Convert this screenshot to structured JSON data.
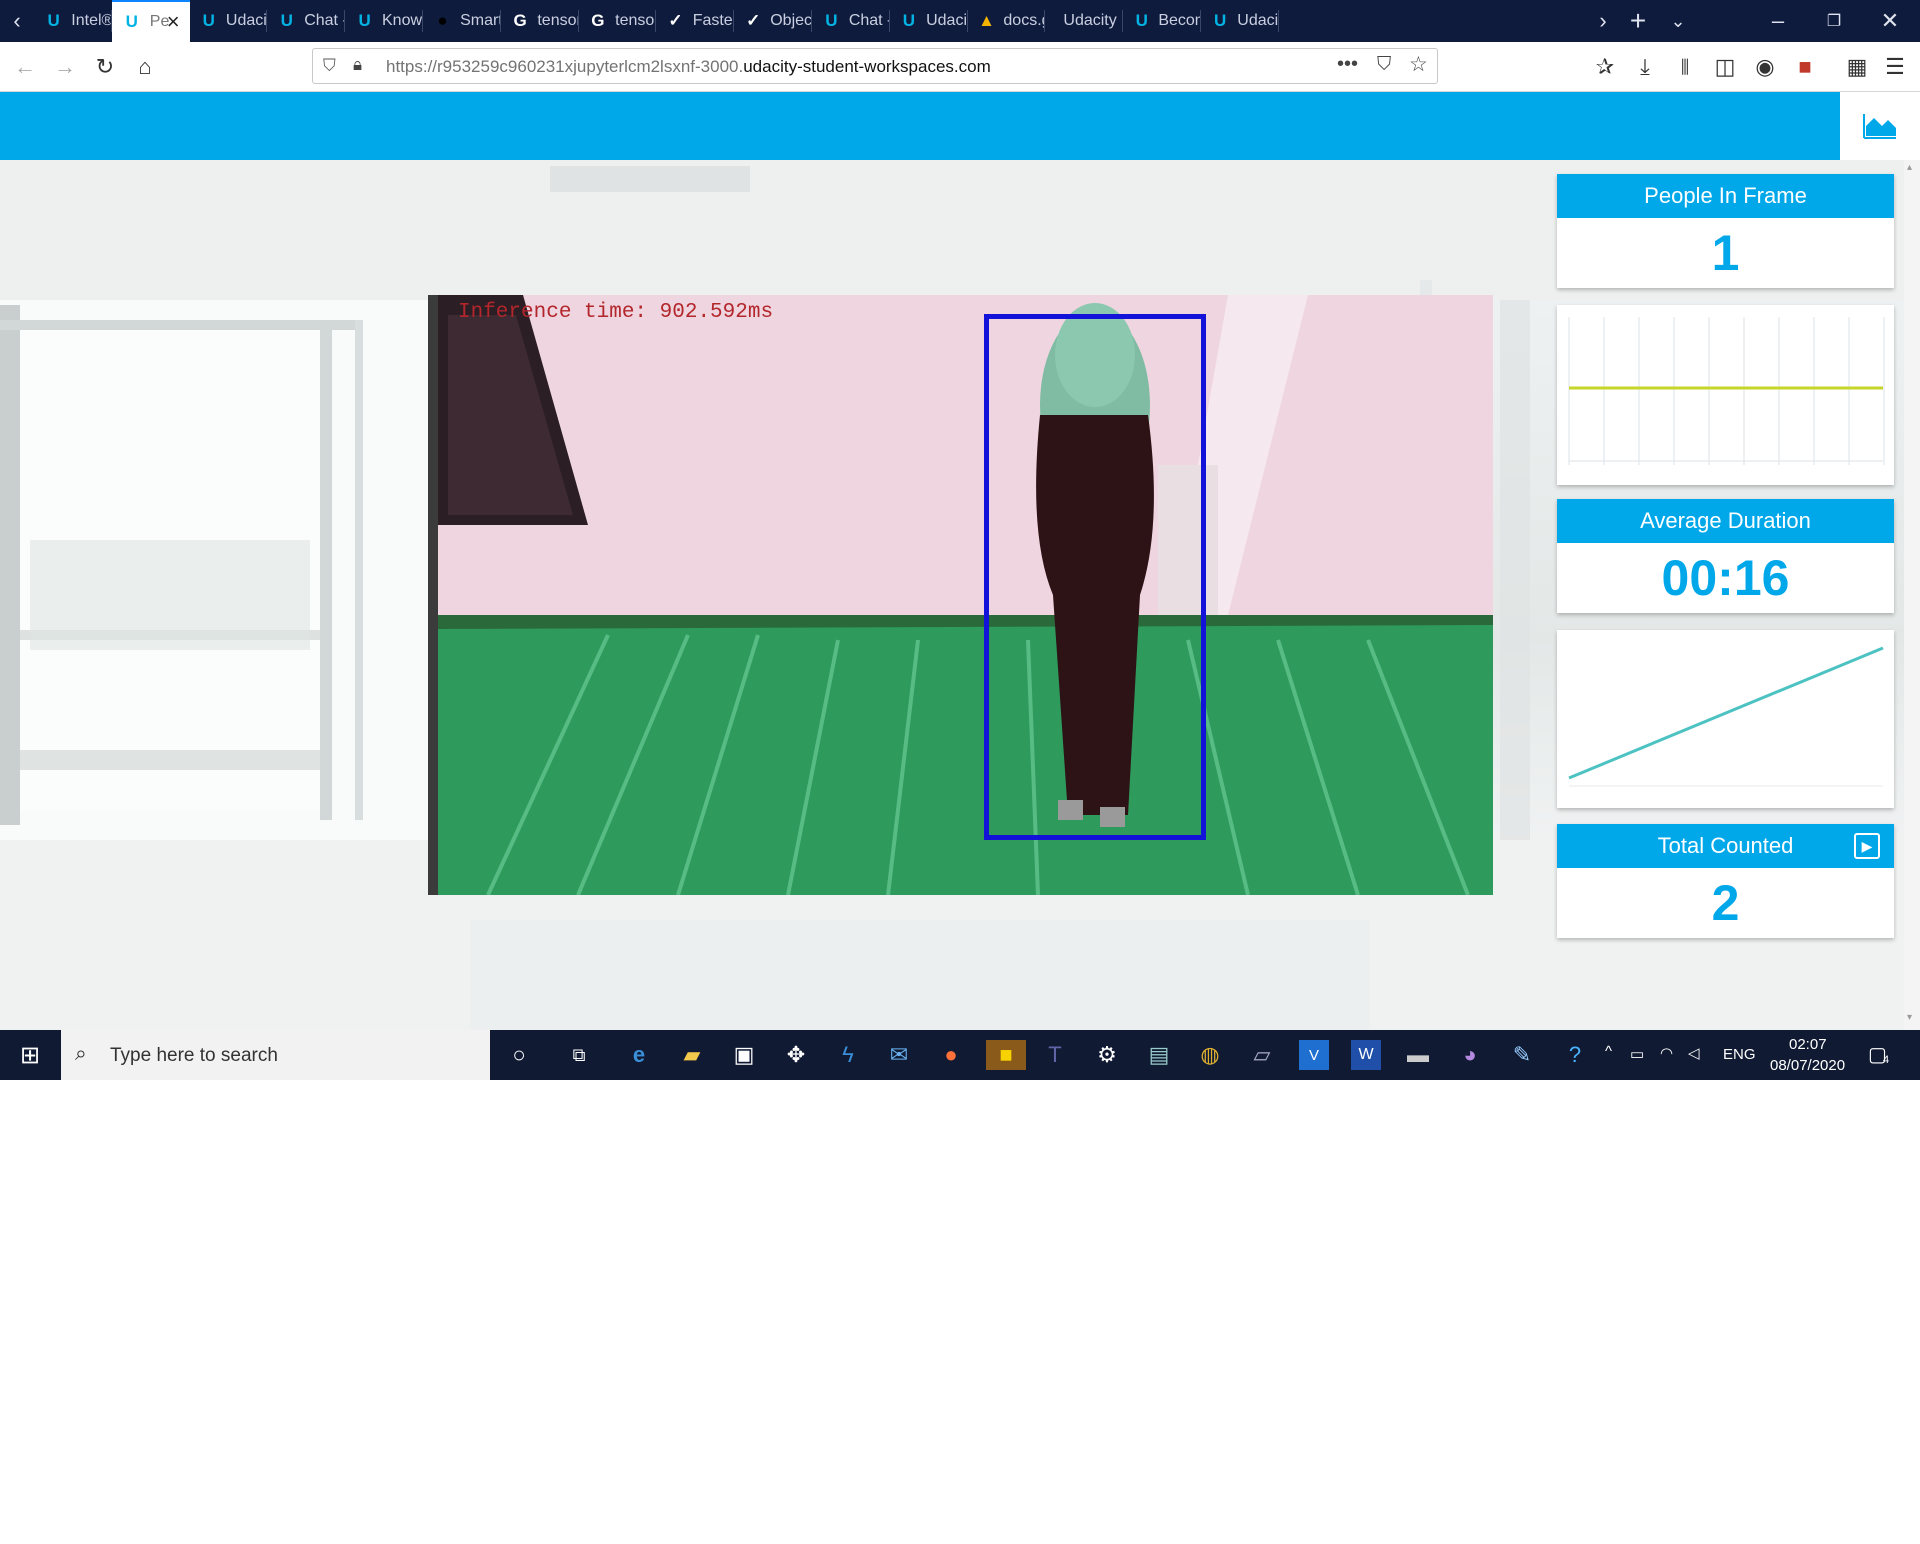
{
  "browser": {
    "tabs": [
      {
        "label": "Intel®",
        "icon": "udacity-icon",
        "active": false
      },
      {
        "label": "Pe",
        "icon": "udacity-icon",
        "active": true
      },
      {
        "label": "Udacit",
        "icon": "udacity-icon",
        "active": false
      },
      {
        "label": "Chat -",
        "icon": "udacity-icon",
        "active": false
      },
      {
        "label": "Knowl",
        "icon": "udacity-icon",
        "active": false
      },
      {
        "label": "Smart",
        "icon": "github-icon",
        "active": false
      },
      {
        "label": "tensor",
        "icon": "google-icon",
        "active": false
      },
      {
        "label": "tensor",
        "icon": "google-icon",
        "active": false
      },
      {
        "label": "Faster",
        "icon": "paper-icon",
        "active": false
      },
      {
        "label": "Object",
        "icon": "paper-icon",
        "active": false
      },
      {
        "label": "Chat -",
        "icon": "udacity-icon",
        "active": false
      },
      {
        "label": "Udacit",
        "icon": "udacity-icon",
        "active": false
      },
      {
        "label": "docs.g",
        "icon": "google-drive-icon",
        "active": false
      },
      {
        "label": "Udacity N",
        "icon": "none",
        "active": false
      },
      {
        "label": "Becom",
        "icon": "udacity-icon",
        "active": false
      },
      {
        "label": "Udacit",
        "icon": "udacity-icon",
        "active": false
      }
    ],
    "url_prefix": "https://r953259c960231xjupyterlcm2lsxnf-3000.",
    "url_domain": "udacity-student-workspaces.com"
  },
  "video": {
    "inference_text": "Inference time: 902.592ms"
  },
  "panels": {
    "people_in_frame": {
      "title": "People In Frame",
      "value": "1"
    },
    "average_duration": {
      "title": "Average Duration",
      "value": "00:16"
    },
    "total_counted": {
      "title": "Total Counted",
      "value": "2"
    }
  },
  "taskbar": {
    "search_placeholder": "Type here to search",
    "language": "ENG",
    "time": "02:07",
    "date": "08/07/2020",
    "notification_count": "4"
  },
  "colors": {
    "accent": "#00a8ea",
    "tab_strip": "#0f1b3d",
    "bounding_box": "#1212d8",
    "people_chart_line": "#c6d52a",
    "duration_chart_line": "#4cc2c2"
  }
}
